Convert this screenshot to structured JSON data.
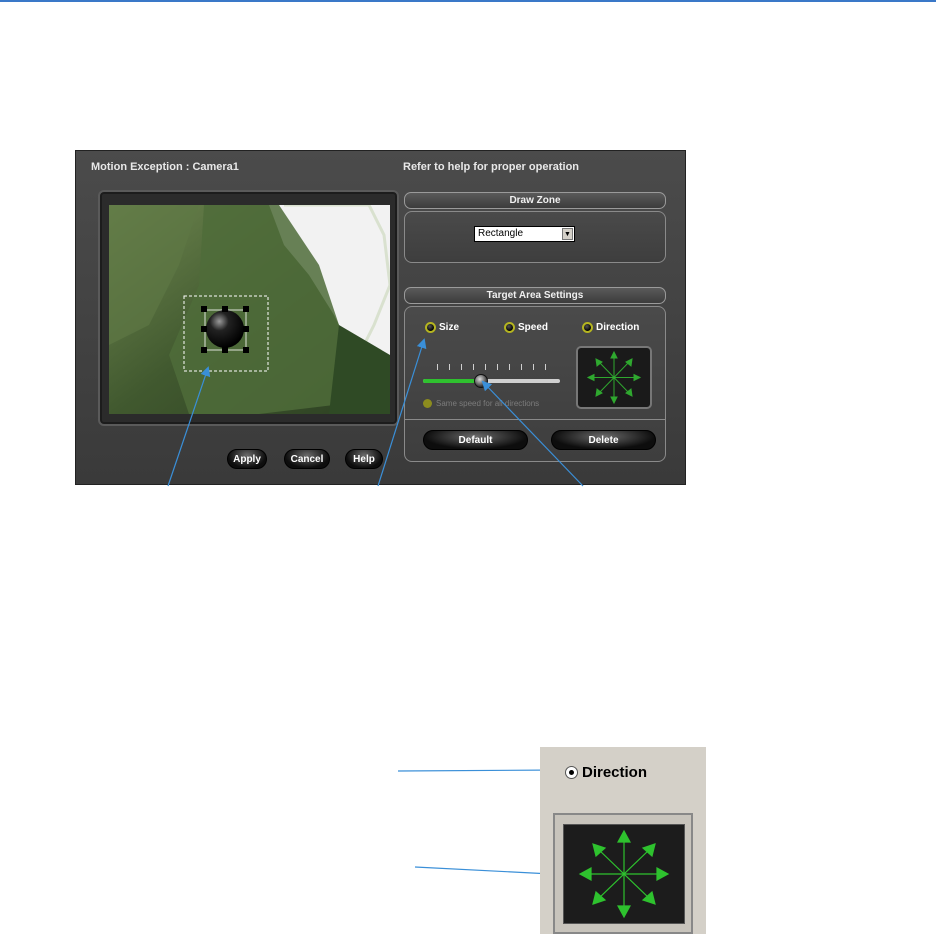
{
  "window": {
    "title_left": "Motion Exception : Camera1",
    "title_right": "Refer to help for proper operation"
  },
  "buttons": {
    "apply": "Apply",
    "cancel": "Cancel",
    "help": "Help",
    "default": "Default",
    "delete": "Delete"
  },
  "draw_zone": {
    "header": "Draw Zone",
    "selected": "Rectangle"
  },
  "target_area": {
    "header": "Target Area Settings",
    "options": [
      "Size",
      "Speed",
      "Direction"
    ],
    "selected": "Size",
    "checkbox_label": "Same speed for all directions",
    "slider_level": 0.42
  },
  "inset": {
    "radio_label": "Direction",
    "icon": "direction-arrows-icon"
  },
  "colors": {
    "annotation": "#3a8fd8",
    "accent_green": "#2fc12f"
  }
}
